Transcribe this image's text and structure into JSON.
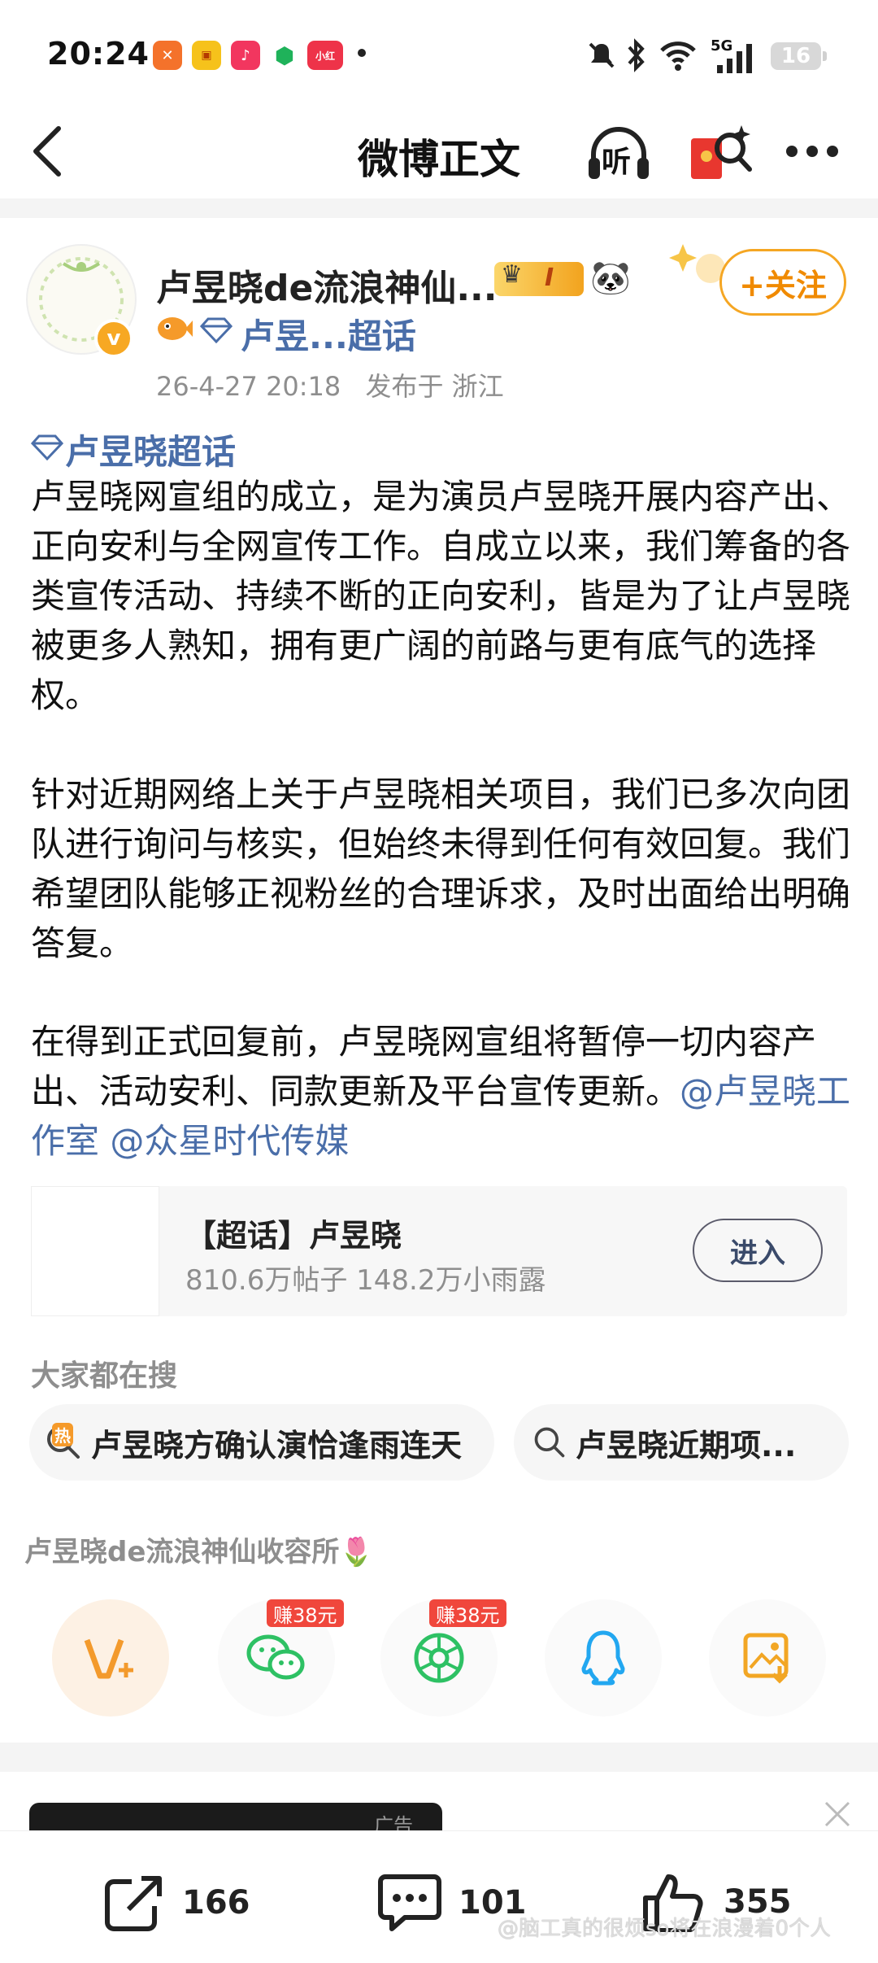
{
  "status_bar": {
    "time": "20:24",
    "battery": "16",
    "network": "5G"
  },
  "nav": {
    "title": "微博正文",
    "listen_label": "听"
  },
  "author": {
    "name": "卢昱晓de流浪神仙...",
    "badge_level": "I",
    "verify_mark": "v",
    "supertopic_short": "卢昱...超话",
    "timestamp": "26-4-27 20:18",
    "location": "发布于 浙江",
    "follow_label": "+关注"
  },
  "post": {
    "supertopic_tag": "卢昱晓超话",
    "paragraph1": "卢昱晓网宣组的成立，是为演员卢昱晓开展内容产出、正向安利与全网宣传工作。自成立以来，我们筹备的各类宣传活动、持续不断的正向安利，皆是为了让卢昱晓被更多人熟知，拥有更广阔的前路与更有底气的选择权。",
    "paragraph2": "针对近期网络上关于卢昱晓相关项目，我们已多次向团队进行询问与核实，但始终未得到任何有效回复。我们希望团队能够正视粉丝的合理诉求，及时出面给出明确答复。",
    "paragraph3": "在得到正式回复前，卢昱晓网宣组将暂停一切内容产出、活动安利、同款更新及平台宣传更新。",
    "mention1": "@卢昱晓工作室",
    "mention2": "@众星时代传媒"
  },
  "supertopic_card": {
    "title": "【超话】卢昱晓",
    "stats": "810.6万帖子 148.2万小雨露",
    "enter_label": "进入"
  },
  "search": {
    "heading": "大家都在搜",
    "hot_badge": "热",
    "items": [
      "卢昱晓方确认演恰逢雨连天",
      "卢昱晓近期项..."
    ]
  },
  "share": {
    "group_name": "卢昱晓de流浪神仙收容所",
    "earn1": "赚38元",
    "earn2": "赚38元"
  },
  "ad": {
    "label": "广告"
  },
  "actions": {
    "repost": "166",
    "comment": "101",
    "like": "355"
  },
  "watermark": "@脑工真的很烦so将在浪漫着0个人"
}
